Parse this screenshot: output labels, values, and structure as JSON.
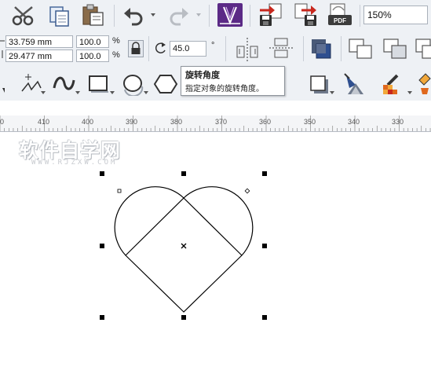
{
  "toolbar_top": {
    "zoom_value": "150%",
    "icons": [
      "cut-icon",
      "copy-icon",
      "paste-icon",
      "undo-icon",
      "redo-icon",
      "app-launcher-icon",
      "import-icon",
      "export-icon",
      "export-pdf-icon"
    ]
  },
  "property_bar": {
    "width_value": "33.759 mm",
    "height_value": "29.477 mm",
    "scale_x": "100.0",
    "scale_y": "100.0",
    "percent_symbol": "%",
    "angle_value": "45.0",
    "degree_symbol": "°"
  },
  "tooltip": {
    "title": "旋转角度",
    "description": "指定对象的旋转角度。"
  },
  "ruler": {
    "labels": [
      "0",
      "410",
      "400",
      "390",
      "380",
      "370",
      "360",
      "350",
      "340",
      "330"
    ]
  },
  "watermark": {
    "title": "软件自学网",
    "url": "WWW.RJZXW.COM"
  },
  "colors": {
    "toolbar_bg": "#eef1f5",
    "accent_blue": "#2f4f8f",
    "accent_purple": "#5b2a86",
    "accent_red": "#c8281e"
  }
}
